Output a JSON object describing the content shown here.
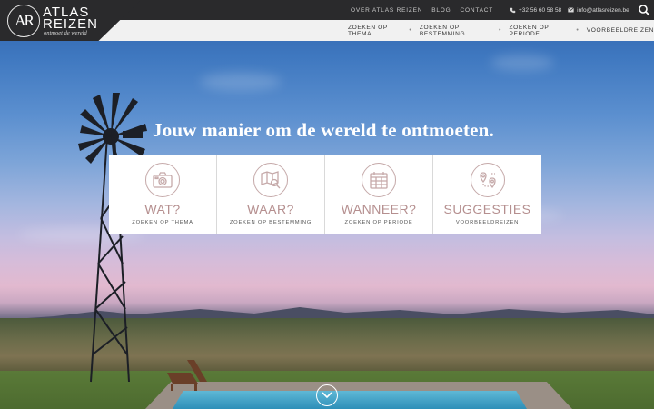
{
  "logo": {
    "monogram": "AR",
    "line1": "ATLAS",
    "line2": "REIZEN",
    "tagline": "ontmoet de wereld"
  },
  "top_nav": [
    "OVER ATLAS REIZEN",
    "BLOG",
    "CONTACT"
  ],
  "contact": {
    "phone": "+32 56 60 58 58",
    "phone_icon": "phone-icon",
    "email": "info@atlasreizen.be",
    "email_icon": "envelope-icon"
  },
  "sub_nav": [
    "ZOEKEN OP THEMA",
    "ZOEKEN OP BESTEMMING",
    "ZOEKEN OP PERIODE",
    "VOORBEELDREIZEN"
  ],
  "headline": "Jouw manier om de wereld te ontmoeten.",
  "cards": [
    {
      "title": "WAT?",
      "sub": "ZOEKEN OP THEMA",
      "icon": "camera-icon"
    },
    {
      "title": "WAAR?",
      "sub": "ZOEKEN OP BESTEMMING",
      "icon": "map-search-icon"
    },
    {
      "title": "WANNEER?",
      "sub": "ZOEKEN OP PERIODE",
      "icon": "calendar-icon"
    },
    {
      "title": "SUGGESTIES",
      "sub": "VOORBEELDREIZEN",
      "icon": "route-pins-icon"
    }
  ],
  "colors": {
    "accent": "#b58f8f",
    "header_dark": "#2a2a2c",
    "subnav_bg": "#f1f1f1"
  }
}
